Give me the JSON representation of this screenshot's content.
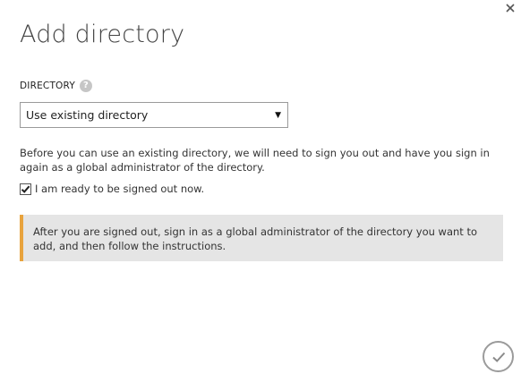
{
  "dialog": {
    "title": "Add directory",
    "close_icon": "close-icon"
  },
  "directory_field": {
    "label": "DIRECTORY",
    "help_icon": "question-mark-icon",
    "help_glyph": "?",
    "selected_value": "Use existing directory",
    "caret_glyph": "▼"
  },
  "info_text": "Before you can use an existing directory, we will need to sign you out and have you sign in again as a global administrator of the directory.",
  "ready_checkbox": {
    "label": "I am ready to be signed out now.",
    "checked": true
  },
  "notice": {
    "text": "After you are signed out, sign in as a global administrator of the directory you want to add, and then follow the instructions.",
    "accent_color": "#e8a33d"
  },
  "footer": {
    "confirm_icon": "checkmark-icon"
  }
}
